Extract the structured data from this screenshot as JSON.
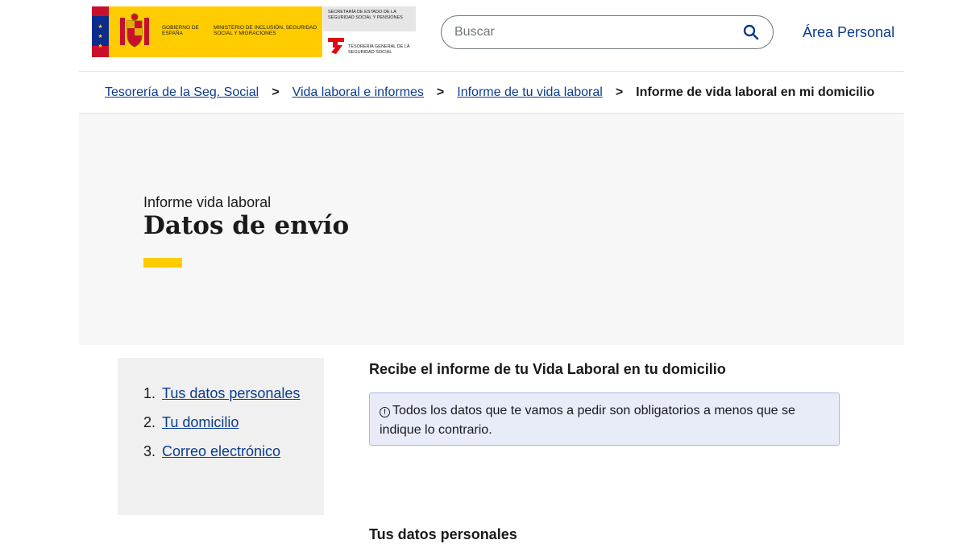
{
  "header": {
    "logo": {
      "gobierno": "Gobierno de España",
      "ministerio": "Ministerio de Inclusión, Seguridad Social y Migraciones",
      "secretaria": "Secretaría de Estado de la Seguridad Social y Pensiones",
      "tesoreria": "Tesorería General de la Seguridad Social"
    },
    "search_placeholder": "Buscar",
    "area_personal": "Área Personal"
  },
  "breadcrumb": {
    "items": [
      "Tesorería de la Seg. Social",
      "Vida laboral e informes",
      "Informe de tu vida laboral"
    ],
    "current": "Informe de vida laboral en mi domicilio",
    "separator": ">"
  },
  "hero": {
    "subtitle": "Informe vida laboral",
    "title": "Datos de envío",
    "accent_color": "#ffcc00"
  },
  "steps": [
    {
      "num": "1.",
      "label": "Tus datos personales"
    },
    {
      "num": "2.",
      "label": "Tu domicilio"
    },
    {
      "num": "3.",
      "label": "Correo electrónico"
    }
  ],
  "main": {
    "heading": "Recibe el informe de tu Vida Laboral en tu domicilio",
    "notice": "Todos los datos que te vamos a pedir son obligatorios a menos que se indique lo contrario.",
    "section_heading": "Tus datos personales"
  },
  "colors": {
    "link": "#0b3c8f",
    "notice_bg": "#e8ecf9",
    "hero_bg": "#f7f7f7"
  }
}
